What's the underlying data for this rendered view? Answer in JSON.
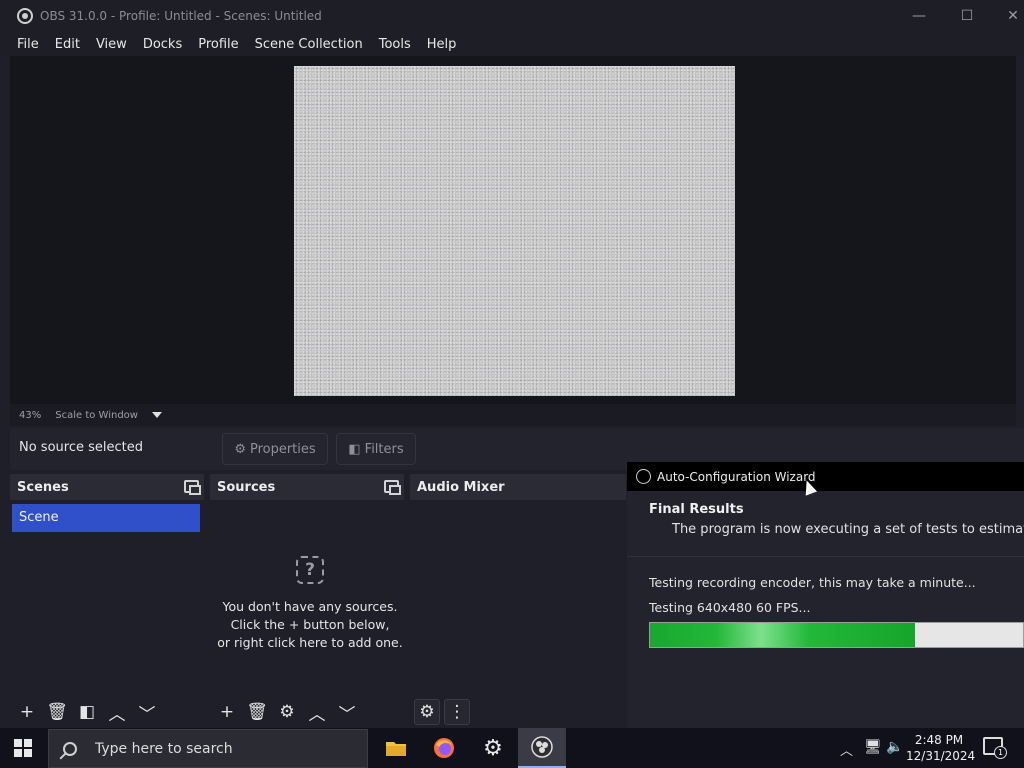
{
  "window": {
    "title": "OBS 31.0.0 - Profile: Untitled - Scenes: Untitled",
    "controls": {
      "minimize": "—",
      "maximize": "☐",
      "close": "✕"
    }
  },
  "menu": [
    "File",
    "Edit",
    "View",
    "Docks",
    "Profile",
    "Scene Collection",
    "Tools",
    "Help"
  ],
  "preview": {
    "zoom": "43%",
    "scale_mode": "Scale to Window"
  },
  "context_bar": {
    "status": "No source selected",
    "properties_label": "Properties",
    "filters_label": "Filters"
  },
  "docks": {
    "scenes": {
      "title": "Scenes",
      "items": [
        "Scene"
      ]
    },
    "sources": {
      "title": "Sources",
      "empty_line1": "You don't have any sources.",
      "empty_line2": "Click the + button below,",
      "empty_line3": "or right click here to add one."
    },
    "audio_mixer": {
      "title": "Audio Mixer"
    }
  },
  "wizard": {
    "title": "Auto-Configuration Wizard",
    "heading": "Final Results",
    "description": "The program is now executing a set of tests to estimate the",
    "status1": "Testing recording encoder, this may take a minute...",
    "status2": "Testing 640x480 60 FPS...",
    "progress": 0.71
  },
  "taskbar": {
    "search_placeholder": "Type here to search",
    "time": "2:48 PM",
    "date": "12/31/2024",
    "notification_count": "1"
  },
  "colors": {
    "accent": "#3050c9",
    "progress_green": "#22b83a"
  }
}
